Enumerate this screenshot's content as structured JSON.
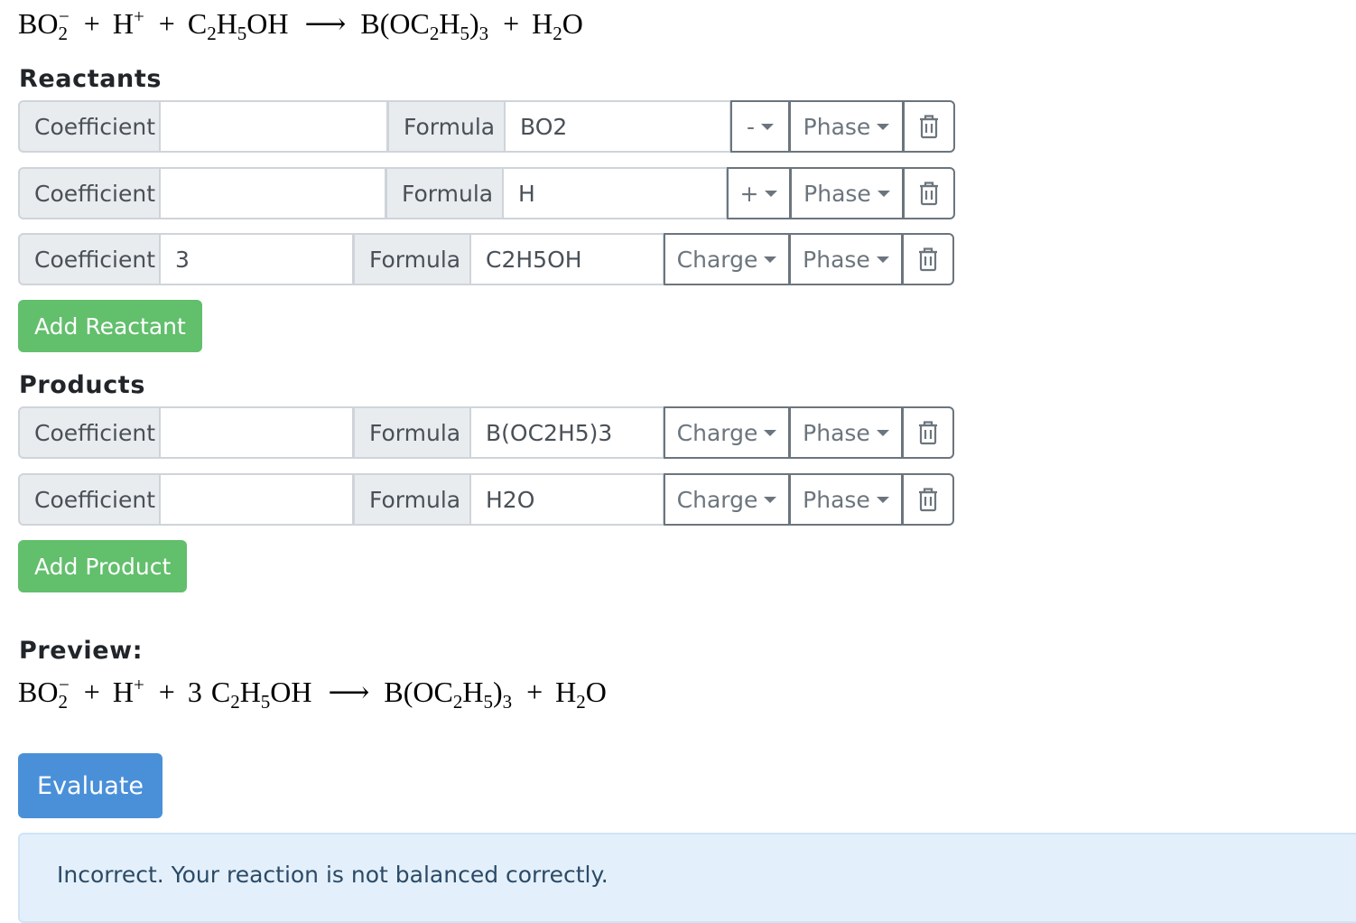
{
  "equation": {
    "reactants": [
      {
        "base": "BO",
        "sub": "2",
        "sup": "−"
      },
      {
        "base": "H",
        "sup": "+"
      },
      {
        "parts": [
          "C",
          "2",
          "H",
          "5",
          "OH"
        ]
      }
    ],
    "arrow": "⟶",
    "products": [
      {
        "parts": [
          "B(OC",
          "2",
          "H",
          "5",
          ")",
          "3"
        ]
      },
      {
        "parts": [
          "H",
          "2",
          "O"
        ]
      }
    ],
    "plus": "+"
  },
  "reactants_heading": "Reactants",
  "products_heading": "Products",
  "labels": {
    "coefficient": "Coefficient",
    "formula": "Formula",
    "phase": "Phase",
    "charge": "Charge"
  },
  "reactants": [
    {
      "coefficient": "",
      "formula": "BO2",
      "charge": "-",
      "phase": "Phase"
    },
    {
      "coefficient": "",
      "formula": "H",
      "charge": "+",
      "phase": "Phase"
    },
    {
      "coefficient": "3",
      "formula": "C2H5OH",
      "charge": "Charge",
      "phase": "Phase"
    }
  ],
  "products": [
    {
      "coefficient": "",
      "formula": "B(OC2H5)3",
      "charge": "Charge",
      "phase": "Phase"
    },
    {
      "coefficient": "",
      "formula": "H2O",
      "charge": "Charge",
      "phase": "Phase"
    }
  ],
  "add_reactant_label": "Add Reactant",
  "add_product_label": "Add Product",
  "preview_label": "Preview:",
  "preview_coefficient": "3",
  "evaluate_label": "Evaluate",
  "feedback": "Incorrect. Your reaction is not balanced correctly.",
  "icons": {
    "delete": "trash-icon"
  },
  "colors": {
    "success": "#62bf6c",
    "primary": "#4a90d9",
    "alert_bg": "#e3f0fb",
    "alert_text": "#2c4a66"
  }
}
